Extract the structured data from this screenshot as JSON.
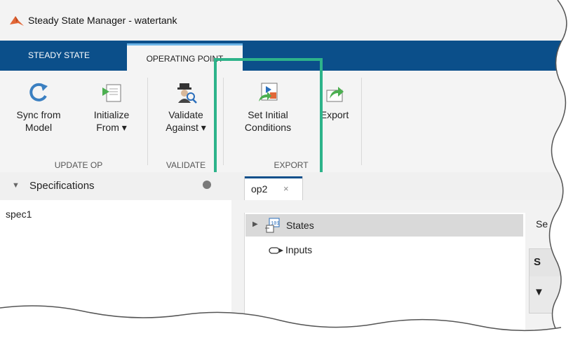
{
  "window": {
    "title": "Steady State Manager - watertank"
  },
  "tabs": [
    {
      "label": "STEADY STATE"
    },
    {
      "label": "OPERATING POINT"
    }
  ],
  "ribbon": {
    "buttons": [
      {
        "label1": "Sync from",
        "label2": "Model",
        "icon": "sync-icon"
      },
      {
        "label1": "Initialize",
        "label2": "From ▾",
        "icon": "initialize-icon"
      },
      {
        "label1": "Validate",
        "label2": "Against ▾",
        "icon": "validate-icon"
      },
      {
        "label1": "Set Initial",
        "label2": "Conditions",
        "icon": "set-initial-conditions-icon"
      },
      {
        "label1": "Export",
        "label2": "",
        "icon": "export-icon"
      }
    ],
    "groups": [
      {
        "label": "UPDATE OP"
      },
      {
        "label": "VALIDATE"
      },
      {
        "label": "EXPORT"
      }
    ]
  },
  "left_panel": {
    "header": "Specifications",
    "items": [
      {
        "label": "spec1"
      }
    ]
  },
  "document": {
    "tab": {
      "label": "op2",
      "close": "×"
    },
    "tree": [
      {
        "label": "States"
      },
      {
        "label": "Inputs"
      }
    ],
    "right_label": "Se",
    "table_header": "S",
    "table_row": "▼"
  },
  "colors": {
    "tabbar": "#0b4f8a",
    "highlight": "#2db38a"
  }
}
